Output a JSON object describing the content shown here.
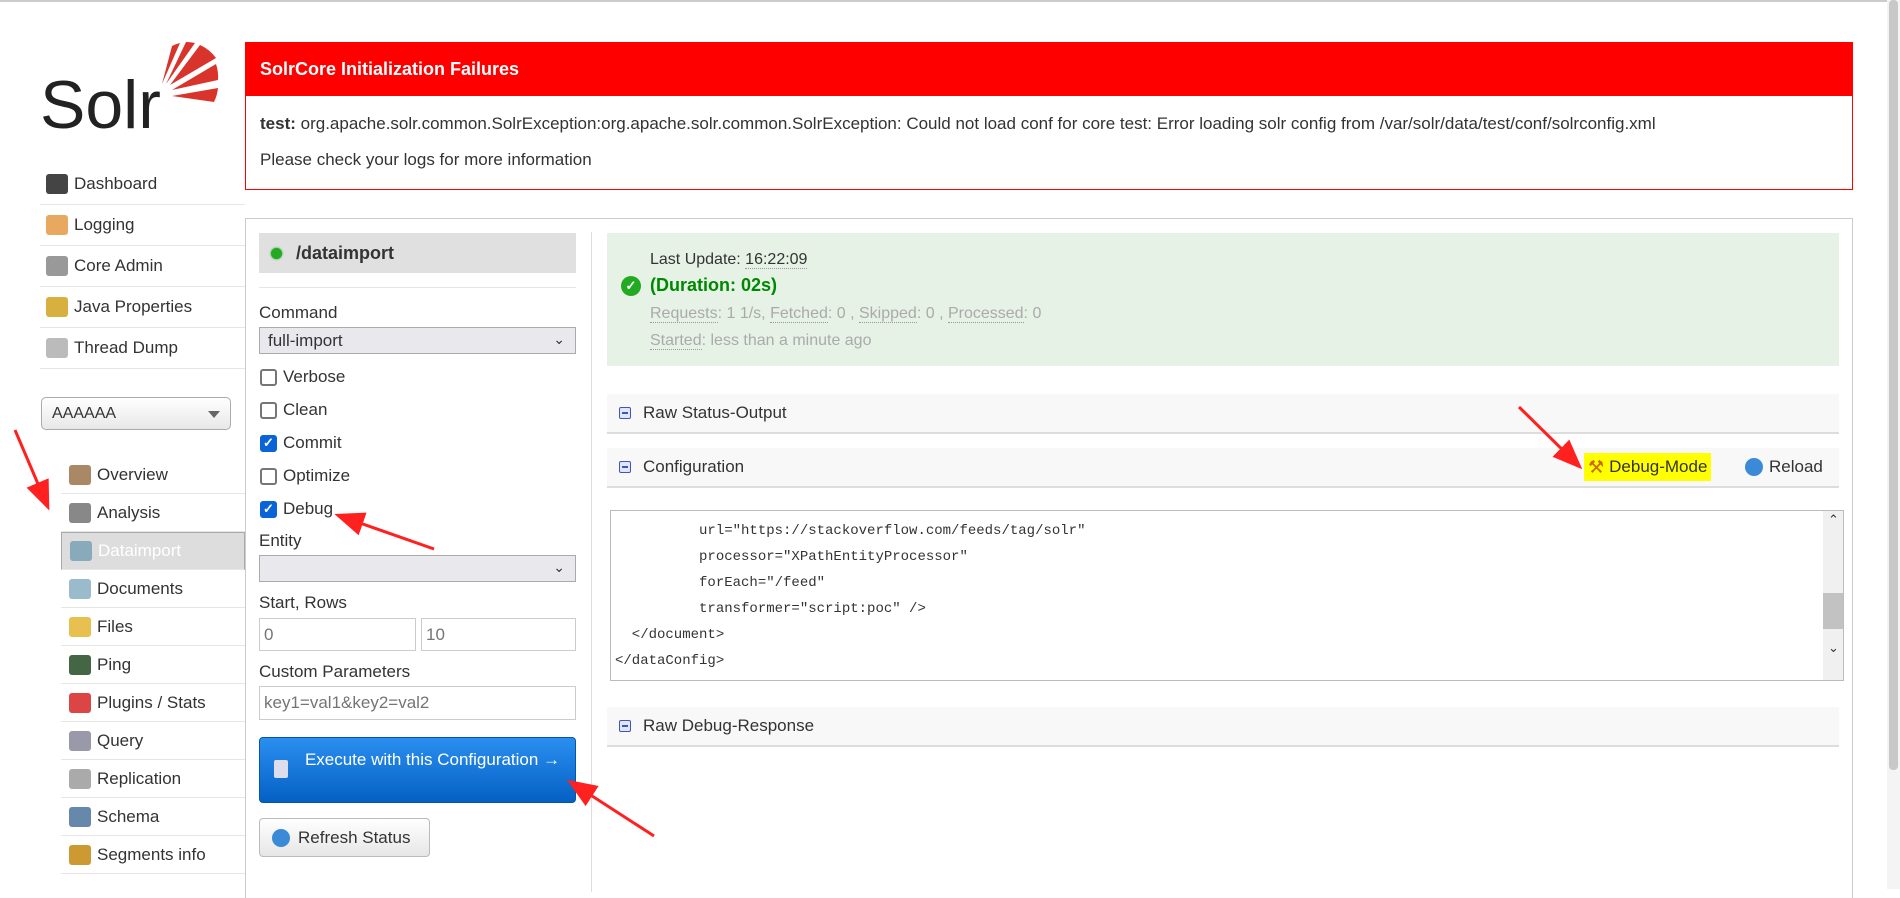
{
  "logo": {
    "text": "Solr"
  },
  "error": {
    "title": "SolrCore Initialization Failures",
    "core": "test:",
    "message": " org.apache.solr.common.SolrException:org.apache.solr.common.SolrException: Could not load conf for core test: Error loading solr config from /var/solr/data/test/conf/solrconfig.xml",
    "hint": "Please check your logs for more information"
  },
  "nav": [
    {
      "label": "Dashboard",
      "icon": "dashboard-icon",
      "color": "#444"
    },
    {
      "label": "Logging",
      "icon": "logging-icon",
      "color": "#e8a860"
    },
    {
      "label": "Core Admin",
      "icon": "core-admin-icon",
      "color": "#999"
    },
    {
      "label": "Java Properties",
      "icon": "java-properties-icon",
      "color": "#d8b040"
    },
    {
      "label": "Thread Dump",
      "icon": "thread-dump-icon",
      "color": "#bbb"
    }
  ],
  "core_selector": {
    "value": "AAAAAA"
  },
  "core_nav": [
    {
      "label": "Overview",
      "icon": "home-icon",
      "color": "#a86"
    },
    {
      "label": "Analysis",
      "icon": "funnel-icon",
      "color": "#888"
    },
    {
      "label": "Dataimport",
      "icon": "dataimport-icon",
      "color": "#8ab",
      "selected": true
    },
    {
      "label": "Documents",
      "icon": "documents-icon",
      "color": "#9bc"
    },
    {
      "label": "Files",
      "icon": "folder-icon",
      "color": "#e8c050"
    },
    {
      "label": "Ping",
      "icon": "ping-icon",
      "color": "#464"
    },
    {
      "label": "Plugins / Stats",
      "icon": "plugins-icon",
      "color": "#d44"
    },
    {
      "label": "Query",
      "icon": "magnifier-icon",
      "color": "#99a"
    },
    {
      "label": "Replication",
      "icon": "replication-icon",
      "color": "#aaa"
    },
    {
      "label": "Schema",
      "icon": "schema-icon",
      "color": "#68a"
    },
    {
      "label": "Segments info",
      "icon": "segments-icon",
      "color": "#c93"
    }
  ],
  "dataimport": {
    "handler": "/dataimport",
    "command_label": "Command",
    "command_value": "full-import",
    "options": [
      {
        "label": "Verbose",
        "checked": false
      },
      {
        "label": "Clean",
        "checked": false
      },
      {
        "label": "Commit",
        "checked": true
      },
      {
        "label": "Optimize",
        "checked": false
      },
      {
        "label": "Debug",
        "checked": true
      }
    ],
    "entity_label": "Entity",
    "entity_value": "",
    "start_rows_label": "Start, Rows",
    "start_placeholder": "0",
    "rows_placeholder": "10",
    "custom_label": "Custom Parameters",
    "custom_placeholder": "key1=val1&key2=val2",
    "execute_label": "Execute with this Configuration →",
    "refresh_label": "Refresh Status"
  },
  "status": {
    "last_update_label": "Last Update: ",
    "last_update": "16:22:09",
    "duration": "(Duration: 02s)",
    "requests_label": "Requests",
    "requests": ": 1 1/s, ",
    "fetched_label": "Fetched",
    "fetched": ": 0 , ",
    "skipped_label": "Skipped",
    "skipped": ": 0 , ",
    "processed_label": "Processed",
    "processed": ": 0",
    "started_label": "Started",
    "started": ": less than a minute ago"
  },
  "sections": {
    "raw_status": "Raw Status-Output",
    "configuration": "Configuration",
    "debug_mode": "Debug-Mode",
    "reload": "Reload",
    "raw_debug": "Raw Debug-Response"
  },
  "config_lines": [
    "          url=\"https://stackoverflow.com/feeds/tag/solr\"",
    "          processor=\"XPathEntityProcessor\"",
    "          forEach=\"/feed\"",
    "          transformer=\"script:poc\" />",
    "  </document>",
    "</dataConfig>"
  ],
  "colors": {
    "error": "#ff0000",
    "success_bg": "#e6f2e6",
    "highlight": "#ffff00",
    "annotation": "#ff2020"
  }
}
